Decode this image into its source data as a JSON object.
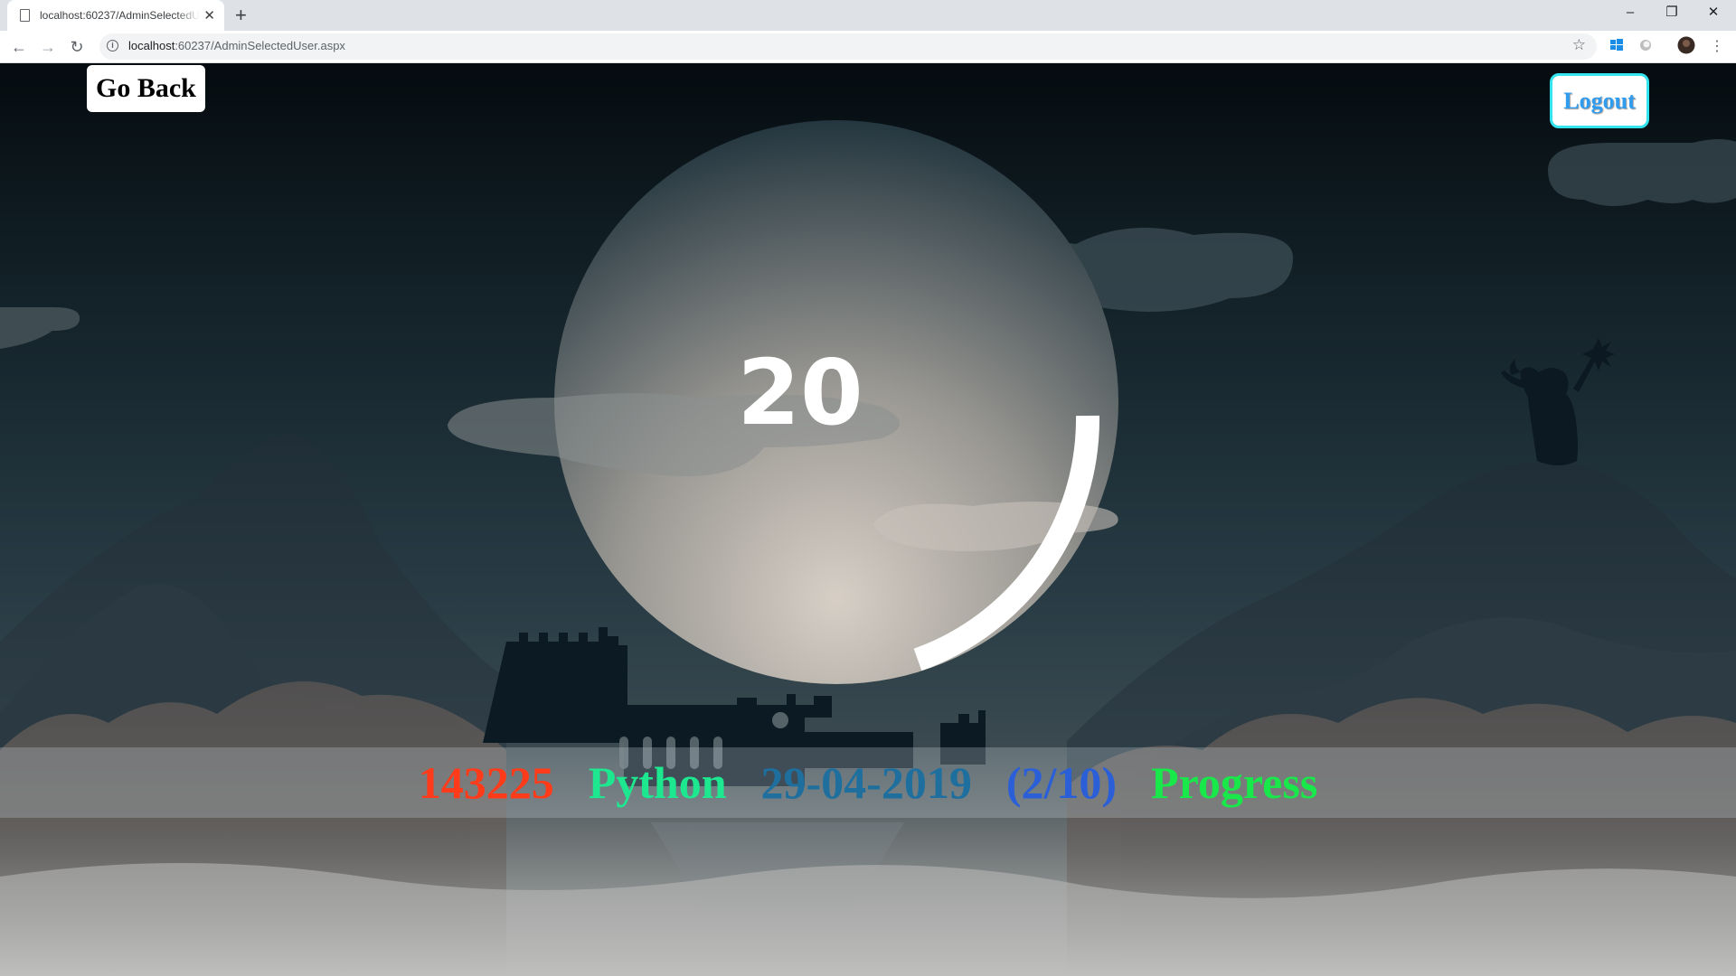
{
  "browser": {
    "tab_title": "localhost:60237/AdminSelectedUser.aspx",
    "url_host": "localhost",
    "url_rest": ":60237/AdminSelectedUser.aspx"
  },
  "page": {
    "go_back_label": "Go Back",
    "logout_label": "Logout",
    "counter": "20",
    "progress_fraction": 0.2,
    "info": {
      "id": "143225",
      "course": "Python",
      "date": "29-04-2019",
      "score": "(2/10)",
      "status": "Progress"
    }
  },
  "colors": {
    "id": "#ff3b1a",
    "course": "#1ee88f",
    "date": "#1e6f9e",
    "score": "#2a5fd8",
    "status": "#19e84a",
    "logout_border": "#33e4ee",
    "logout_text": "#2f9cf0"
  }
}
